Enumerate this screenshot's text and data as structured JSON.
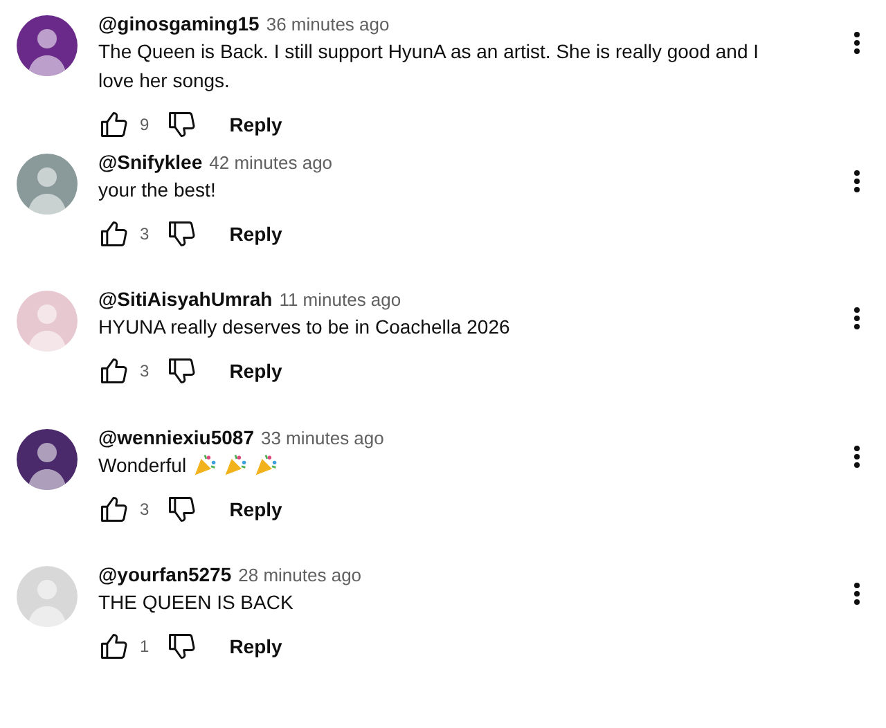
{
  "comments": [
    {
      "handle": "@ginosgaming15",
      "time": "36 minutes ago",
      "text": "The Queen is Back. I still support HyunA as an artist. She is really good and I love her songs.",
      "likes": "9",
      "reply": "Reply",
      "color": "#6a2a8a"
    },
    {
      "handle": "@Snifyklee",
      "time": "42 minutes ago",
      "text": "your the best!",
      "likes": "3",
      "reply": "Reply",
      "color": "#8a9a9a"
    },
    {
      "handle": "@SitiAisyahUmrah",
      "time": "11 minutes ago",
      "text": "HYUNA really deserves to be in Coachella 2026",
      "likes": "3",
      "reply": "Reply",
      "color": "#e8c8d0"
    },
    {
      "handle": "@wenniexiu5087",
      "time": "33 minutes ago",
      "text": "Wonderful",
      "emojis": [
        {
          "kind": "party"
        },
        {
          "kind": "party"
        },
        {
          "kind": "party"
        }
      ],
      "likes": "3",
      "reply": "Reply",
      "color": "#4a2a6a"
    },
    {
      "handle": "@yourfan5275",
      "time": "28 minutes ago",
      "text": "THE QUEEN IS BACK",
      "likes": "1",
      "reply": "Reply",
      "color": "#d8d8d8"
    }
  ]
}
